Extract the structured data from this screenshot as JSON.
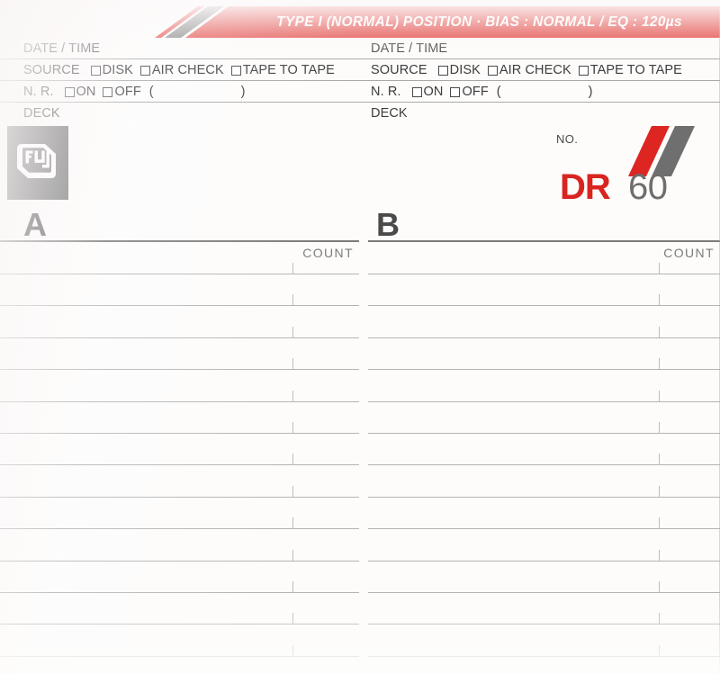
{
  "card": {
    "type_band_text": "TYPE I (NORMAL) POSITION · BIAS : NORMAL / EQ : 120µs",
    "brand_logo_name": "fuji-logo",
    "accent_red": "#dd2622",
    "accent_gray": "#6f6f6f",
    "paper": "#fdfcfb"
  },
  "product": {
    "no_label": "NO.",
    "no_value": "",
    "model": "DR",
    "length": "60"
  },
  "form": {
    "rows": [
      {
        "key": "date_time",
        "label": "DATE / TIME",
        "value": "",
        "options": [],
        "has_paren": false
      },
      {
        "key": "source",
        "label": "SOURCE",
        "value": "",
        "options": [
          "DISK",
          "AIR CHECK",
          "TAPE TO TAPE"
        ],
        "has_paren": false
      },
      {
        "key": "nr",
        "label": "N. R.",
        "value": "",
        "options": [
          "ON",
          "OFF"
        ],
        "has_paren": true,
        "paren_open": "(",
        "paren_close": ")",
        "paren_value": ""
      },
      {
        "key": "deck",
        "label": "DECK",
        "value": "",
        "options": [],
        "has_paren": false
      }
    ]
  },
  "sides": [
    {
      "letter": "A",
      "count_label": "COUNT",
      "line_count": 13,
      "entries": []
    },
    {
      "letter": "B",
      "count_label": "COUNT",
      "line_count": 13,
      "entries": []
    }
  ]
}
